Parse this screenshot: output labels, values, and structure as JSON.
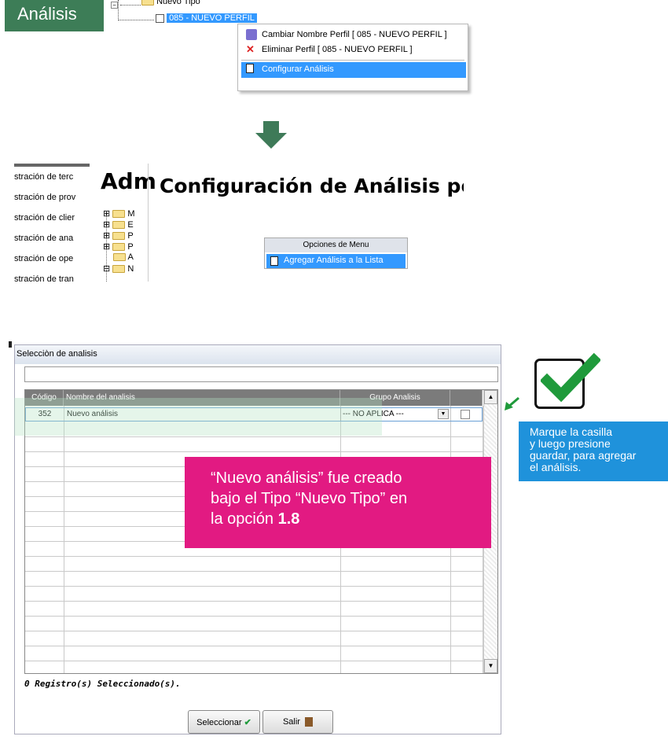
{
  "top": {
    "tag": "Análisis",
    "tree_parent": "Nuevo Tipo",
    "tree_selected": "085 - NUEVO PERFIL",
    "context_menu": [
      {
        "icon": "rename-icon",
        "label": "Cambiar Nombre Perfil [ 085 - NUEVO PERFIL ]"
      },
      {
        "icon": "delete-icon",
        "label": "Eliminar Perfil [ 085 - NUEVO PERFIL ]"
      },
      {
        "icon": "page-icon",
        "label": "Configurar Análisis"
      }
    ]
  },
  "middle": {
    "left_items": [
      "stración de terc",
      "stración de prov",
      "stración de clier",
      "stración de ana",
      "stración de ope",
      "stración de tran"
    ],
    "adm_title": "Adm",
    "tree_letters": [
      "M",
      "E",
      "P",
      "P",
      "A",
      "N"
    ],
    "config_title": "Configuración de Análisis por P",
    "options_menu": {
      "header": "Opciones de Menu",
      "item": "Agregar Análisis a la Lista"
    }
  },
  "dialog": {
    "title": "Selecciòn de analisis",
    "search_value": "",
    "columns": [
      "Código",
      "Nombre del analisis",
      "Grupo Analisis",
      ""
    ],
    "rows": [
      {
        "code": "352",
        "name": "Nuevo análisis",
        "group": "--- NO APLICA ---"
      }
    ],
    "status": "0 Registro(s) Seleccionado(s).",
    "select_button": "Seleccionar",
    "exit_button": "Salir"
  },
  "callouts": {
    "pink_line1": "“Nuevo análisis” fue creado",
    "pink_line2": "bajo el Tipo “Nuevo Tipo” en",
    "pink_line3": "la opción ",
    "pink_bold": "1.8",
    "blue_lines": [
      "Marque la casilla",
      "y luego presione",
      "guardar, para agregar",
      "el análisis."
    ]
  },
  "colors": {
    "tag_green": "#3d7d57",
    "arrow_green": "#3e7a58",
    "highlight_blue": "#3399ff",
    "pink": "#e21a82",
    "note_blue": "#1f92db",
    "check_green": "#1f9a3b"
  }
}
